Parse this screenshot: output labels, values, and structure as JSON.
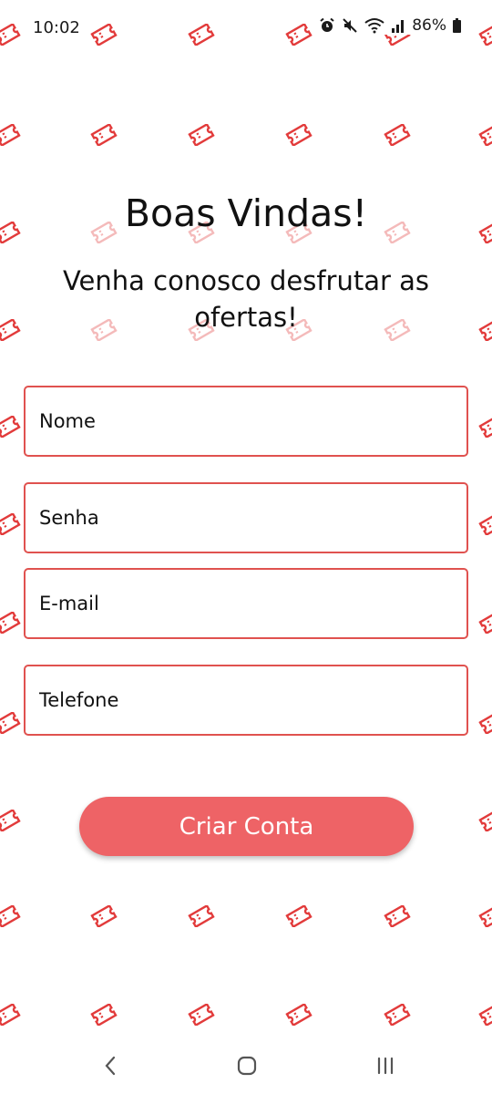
{
  "status_bar": {
    "time": "10:02",
    "battery": "86%",
    "icons": [
      "alarm-icon",
      "mute-icon",
      "wifi-icon",
      "signal-icon",
      "battery-icon"
    ]
  },
  "welcome": {
    "title": "Boas Vindas!",
    "subtitle": "Venha conosco desfrutar as ofertas!"
  },
  "form": {
    "name_placeholder": "Nome",
    "password_placeholder": "Senha",
    "email_placeholder": "E-mail",
    "phone_placeholder": "Telefone",
    "submit_label": "Criar Conta"
  },
  "nav_bar": {
    "buttons": [
      "back-icon",
      "home-icon",
      "recent-apps-icon"
    ]
  },
  "colors": {
    "accent": "#e0524f",
    "button": "#ee6366",
    "pattern": "#e23b3b"
  },
  "background_pattern": "ticket-icon"
}
